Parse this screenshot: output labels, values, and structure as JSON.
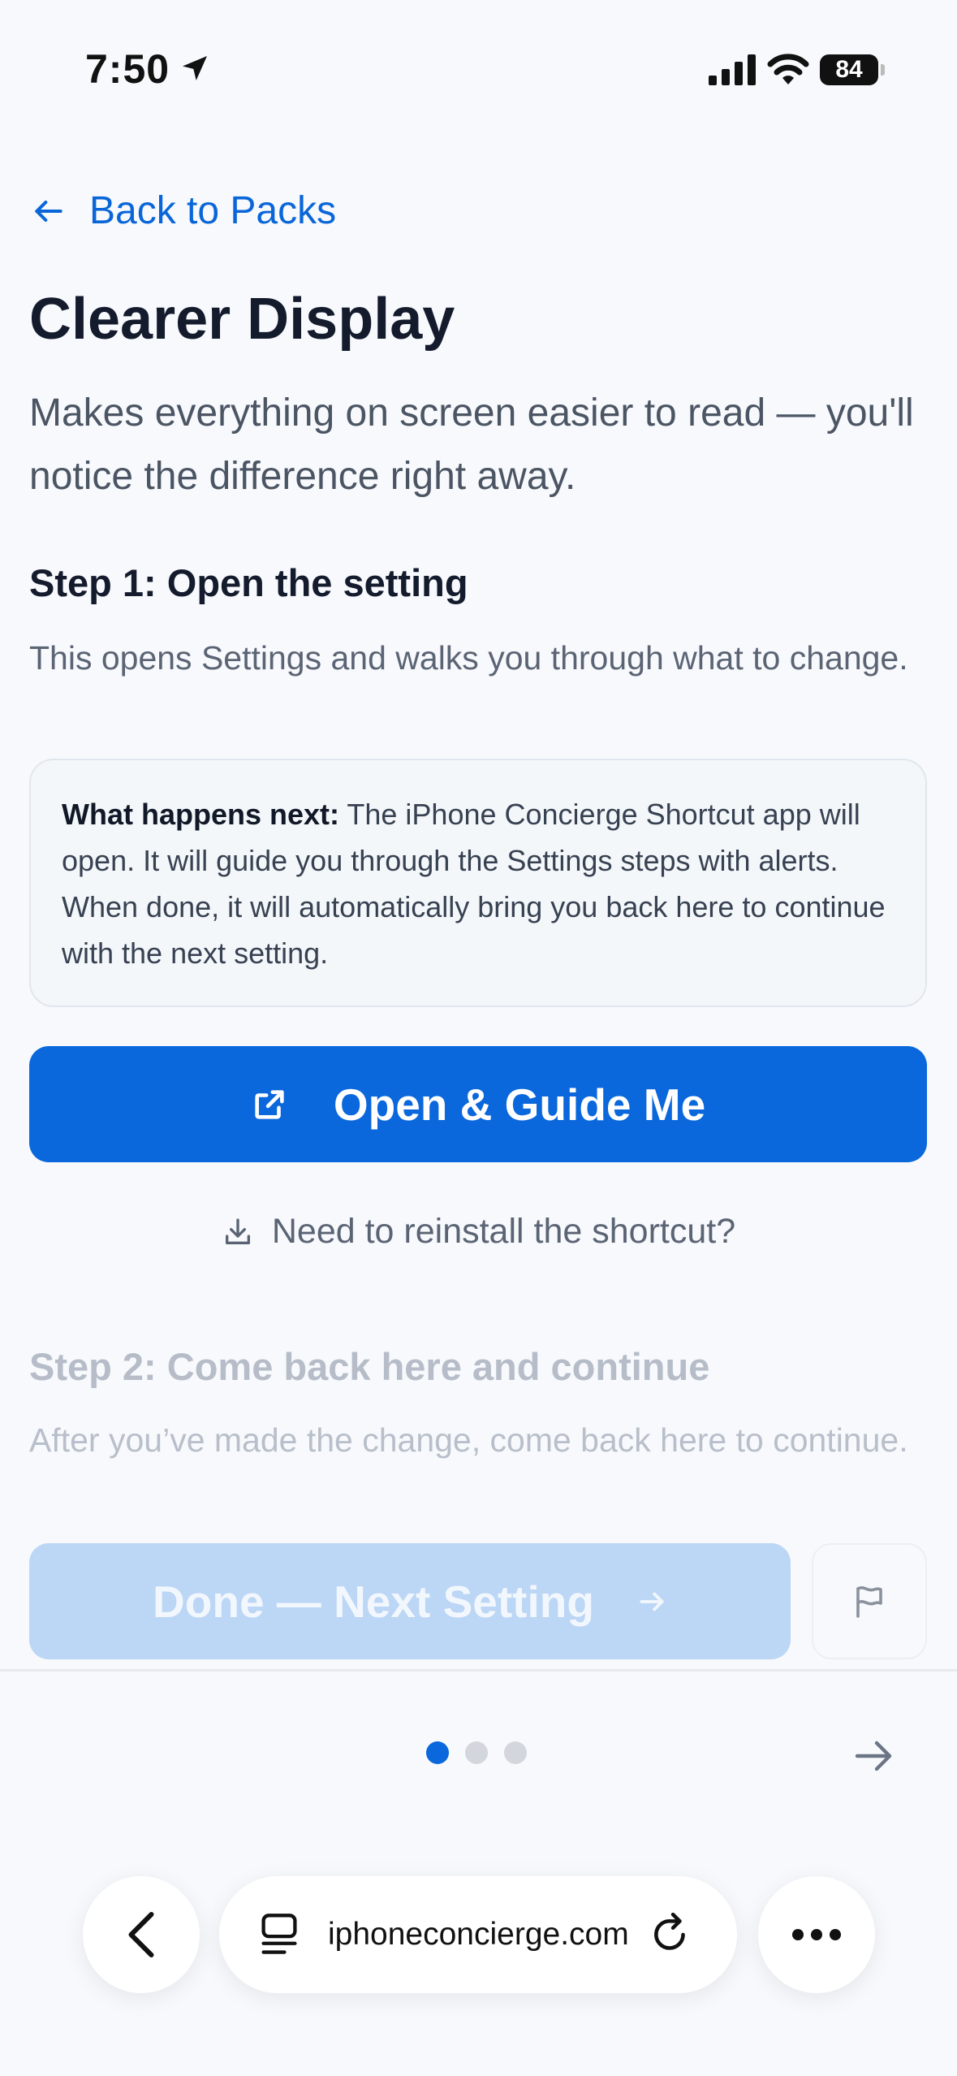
{
  "status_bar": {
    "time": "7:50",
    "battery": "84",
    "icons": [
      "location-arrow-icon",
      "signal-icon",
      "wifi-icon",
      "battery-icon"
    ]
  },
  "nav": {
    "back_label": "Back to Packs"
  },
  "page": {
    "title": "Clearer Display",
    "subtitle": "Makes everything on screen easier to read — you'll notice the difference right away."
  },
  "step1": {
    "heading": "Step 1: Open the setting",
    "description": "This opens Settings and walks you through what to change.",
    "info_label": "What happens next:",
    "info_text": " The iPhone Concierge Shortcut app will open. It will guide you through the Settings steps with alerts. When done, it will automatically bring you back here to continue with the next setting.",
    "button_label": "Open & Guide Me",
    "reinstall_label": "Need to reinstall the shortcut?"
  },
  "step2": {
    "heading": "Step 2: Come back here and continue",
    "description": "After you’ve made the change, come back here to continue.",
    "button_label": "Done — Next Setting"
  },
  "pagination": {
    "total": 3,
    "current": 1
  },
  "browser": {
    "url": "iphoneconcierge.com"
  },
  "colors": {
    "accent": "#0a67dc",
    "disabled_button": "#bcd6f5",
    "background": "#f7f9fc"
  }
}
